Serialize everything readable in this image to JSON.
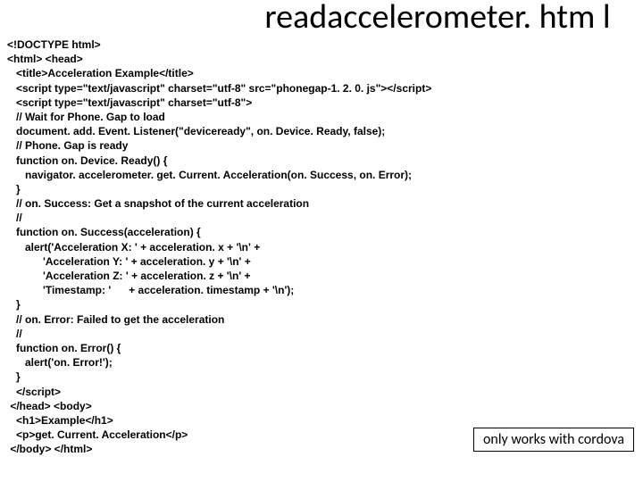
{
  "title_text": "readaccelerometer. htm l",
  "note_text": "only works with cordova",
  "code_lines": [
    "<!DOCTYPE html>",
    "<html> <head>",
    "   <title>Acceleration Example</title>",
    "   <script type=\"text/javascript\" charset=\"utf-8\" src=\"phonegap-1. 2. 0. js\"></script>",
    "   <script type=\"text/javascript\" charset=\"utf-8\">",
    "   // Wait for Phone. Gap to load",
    "   document. add. Event. Listener(\"deviceready\", on. Device. Ready, false);",
    "   // Phone. Gap is ready",
    "   function on. Device. Ready() {",
    "      navigator. accelerometer. get. Current. Acceleration(on. Success, on. Error);",
    "   }",
    "   // on. Success: Get a snapshot of the current acceleration",
    "   //",
    "   function on. Success(acceleration) {",
    "      alert('Acceleration X: ' + acceleration. x + '\\n' +",
    "            'Acceleration Y: ' + acceleration. y + '\\n' +",
    "            'Acceleration Z: ' + acceleration. z + '\\n' +",
    "            'Timestamp: '      + acceleration. timestamp + '\\n');",
    "   }",
    "   // on. Error: Failed to get the acceleration",
    "   //",
    "   function on. Error() {",
    "      alert('on. Error!');",
    "   }",
    "   </script>",
    " </head> <body>",
    "   <h1>Example</h1>",
    "   <p>get. Current. Acceleration</p>",
    " </body> </html>"
  ]
}
